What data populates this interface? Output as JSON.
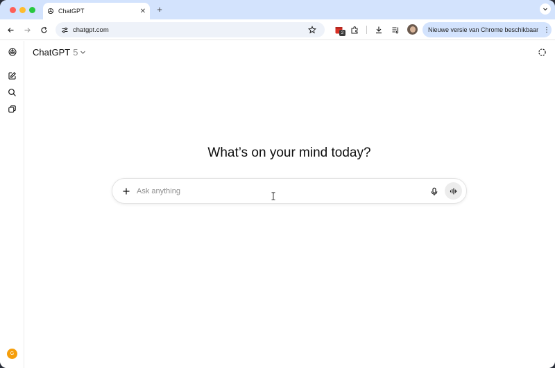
{
  "browser": {
    "tab_title": "ChatGPT",
    "tab_close": "✕",
    "new_tab": "+",
    "url": "chatgpt.com",
    "extension_badge": "2",
    "update_label": "Nieuwe versie van Chrome beschikbaar",
    "menu_glyph": "⋮"
  },
  "app": {
    "model_name": "ChatGPT",
    "model_version": "5",
    "headline": "What’s on your mind today?",
    "composer_placeholder": "Ask anything",
    "user_initial": "G"
  },
  "colors": {
    "tab_strip": "#d3e3fd",
    "update_pill": "#d3e3fd",
    "user_avatar": "#f59e0b"
  }
}
